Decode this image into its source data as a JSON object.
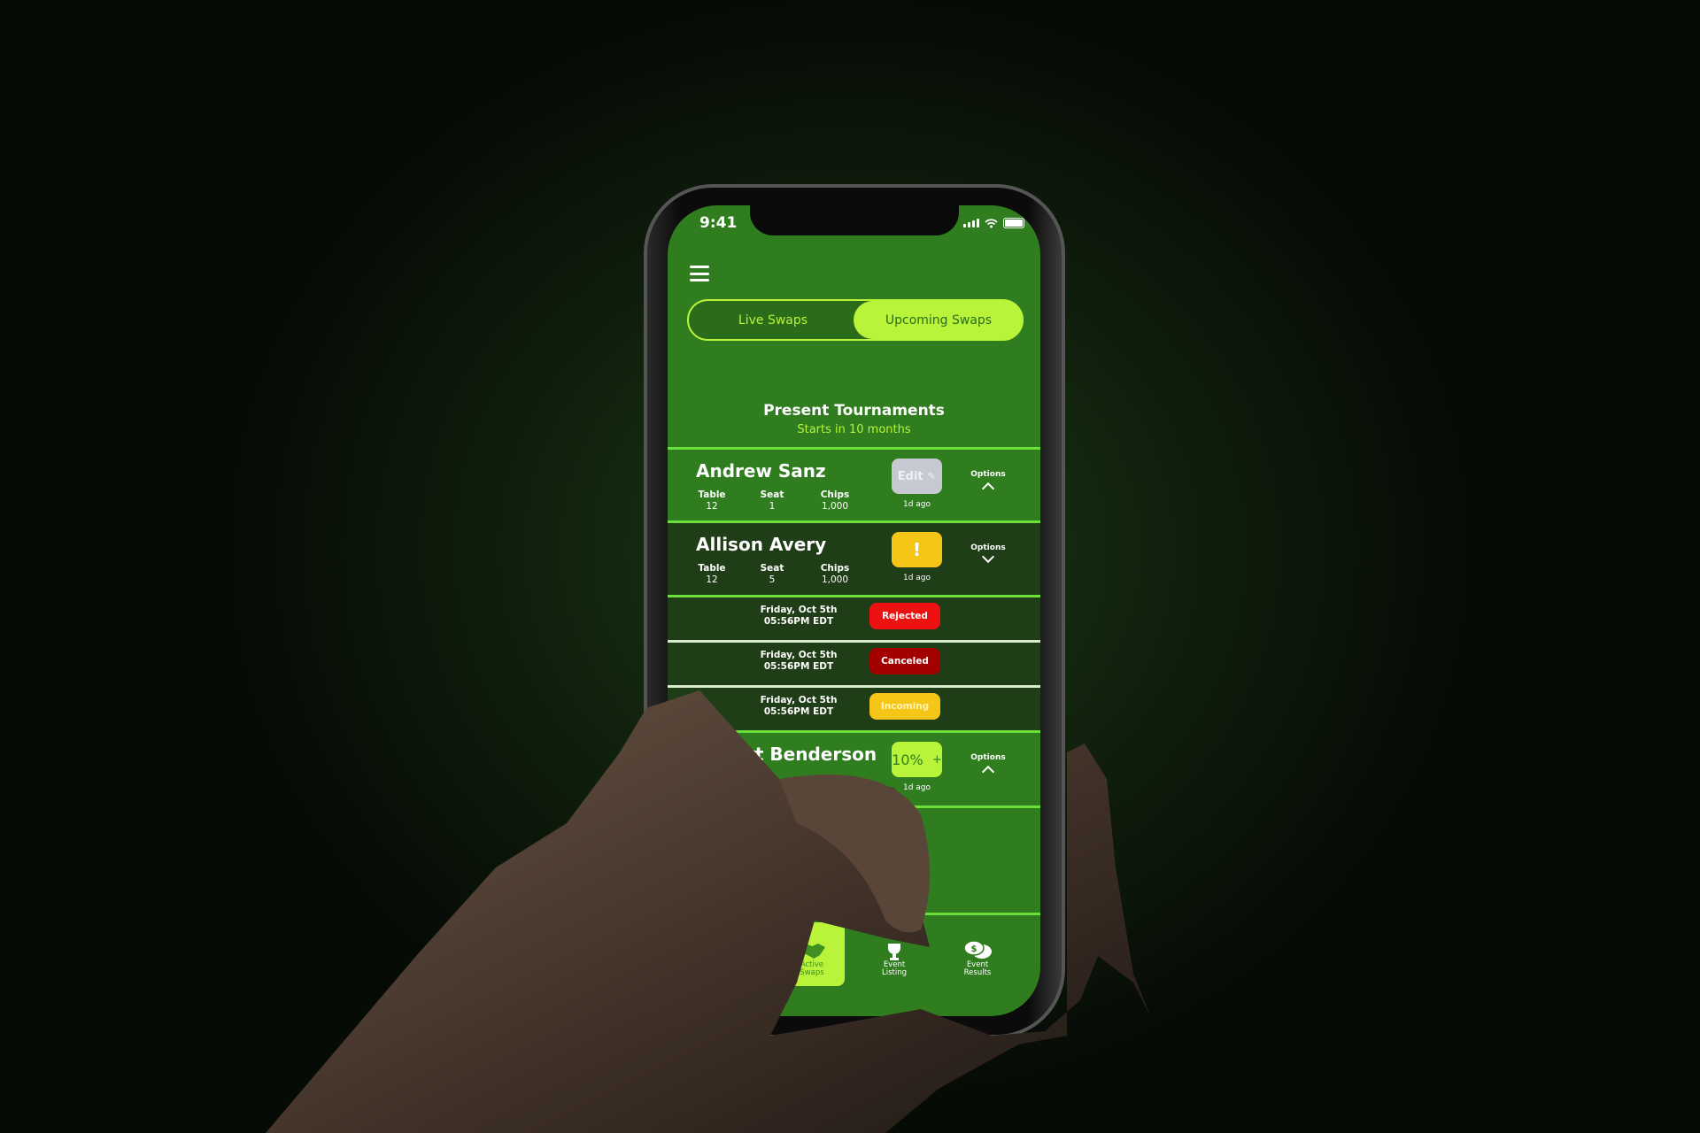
{
  "status_bar": {
    "time": "9:41"
  },
  "toggle": {
    "live": "Live Swaps",
    "upcoming": "Upcoming Swaps",
    "active": "upcoming"
  },
  "section": {
    "title": "Present Tournaments",
    "subtitle": "Starts in 10 months"
  },
  "labels": {
    "table": "Table",
    "seat": "Seat",
    "chips": "Chips",
    "options": "Options",
    "ago": "1d ago"
  },
  "players": [
    {
      "name": "Andrew Sanz",
      "table": "12",
      "seat": "1",
      "chips": "1,000",
      "action": "Edit",
      "action_icon": "edit-icon",
      "expanded": true
    },
    {
      "name": "Allison Avery",
      "table": "12",
      "seat": "5",
      "chips": "1,000",
      "action": "!",
      "action_icon": "alert-icon",
      "expanded": false
    },
    {
      "name": "Robert Benderson",
      "table": "",
      "seat": "",
      "chips": "",
      "action": "10%",
      "action_suffix": "+",
      "expanded": true
    }
  ],
  "swaps": [
    {
      "date": "Friday, Oct 5th",
      "time": "05:56PM EDT",
      "status": "Rejected",
      "color": "#ee1111"
    },
    {
      "date": "Friday, Oct 5th",
      "time": "05:56PM EDT",
      "status": "Canceled",
      "color": "#a30000"
    },
    {
      "date": "Friday, Oct 5th",
      "time": "05:56PM EDT",
      "status": "Incoming",
      "color": "#f5c518"
    }
  ],
  "nav": [
    {
      "label1": "Active",
      "label2": "Swaps",
      "icon": "handshake-icon",
      "active": true
    },
    {
      "label1": "Event",
      "label2": "Listing",
      "icon": "trophy-icon"
    },
    {
      "label1": "Event",
      "label2": "Results",
      "icon": "dollar-chat-icon"
    }
  ],
  "colors": {
    "screen": "#2f7d1e",
    "accent": "#b9f43a",
    "divider": "#6be03a",
    "dark_row": "#1f3d16",
    "edit": "#c6c8d2",
    "alert": "#f5c518"
  }
}
